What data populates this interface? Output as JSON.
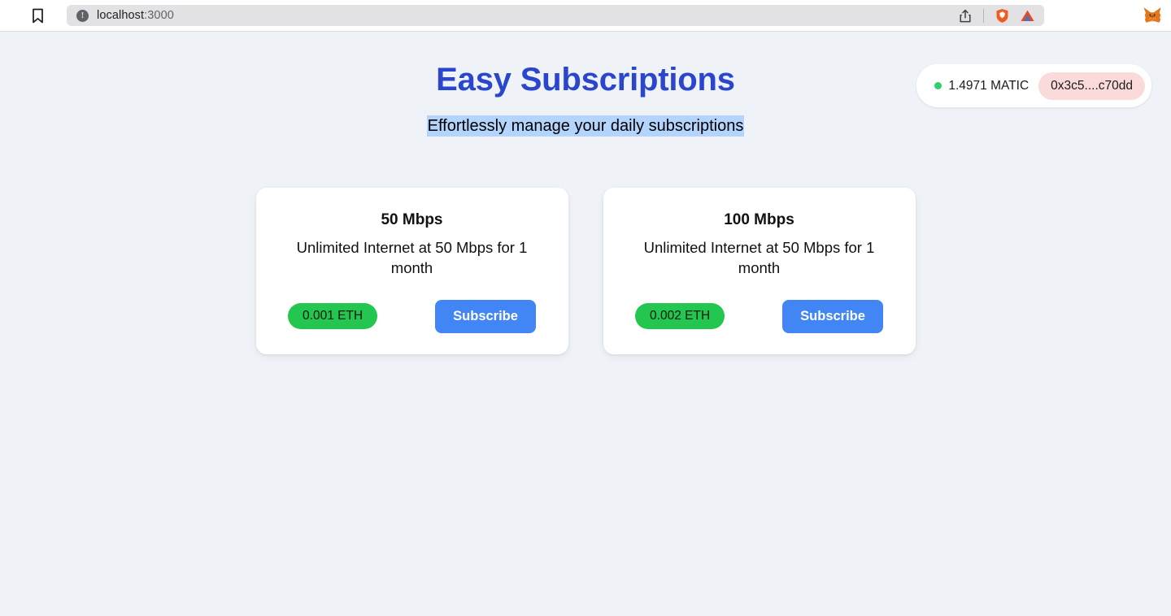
{
  "browser": {
    "bookmark_icon": "bookmark-icon",
    "url_scheme_icon": "site-info-icon",
    "url_host": "localhost",
    "url_port": ":3000",
    "url_full": "localhost:3000",
    "actions": [
      {
        "name": "share-icon",
        "label": "Share"
      },
      {
        "name": "brave-shield-icon",
        "label": "Brave Shields"
      },
      {
        "name": "triangle-icon",
        "label": "Extension"
      }
    ],
    "extension": {
      "name": "metamask-fox-icon",
      "label": "MetaMask"
    }
  },
  "header": {
    "title": "Easy Subscriptions",
    "subtitle": "Effortlessly manage your daily subscriptions",
    "title_color": "#2a46cc",
    "selection_color": "#b3d4fc"
  },
  "wallet": {
    "status": "connected",
    "status_color": "#31ce6c",
    "balance": "1.4971 MATIC",
    "address": "0x3c5....c70dd",
    "address_bg": "#fbdada"
  },
  "plans": [
    {
      "title": "50 Mbps",
      "description": "Unlimited Internet at 50 Mbps for 1 month",
      "price": "0.001 ETH",
      "price_color": "#23c64e",
      "button_label": "Subscribe",
      "button_color": "#4285f4"
    },
    {
      "title": "100 Mbps",
      "description": "Unlimited Internet at 50 Mbps for 1 month",
      "price": "0.002 ETH",
      "price_color": "#23c64e",
      "button_label": "Subscribe",
      "button_color": "#4285f4"
    }
  ]
}
